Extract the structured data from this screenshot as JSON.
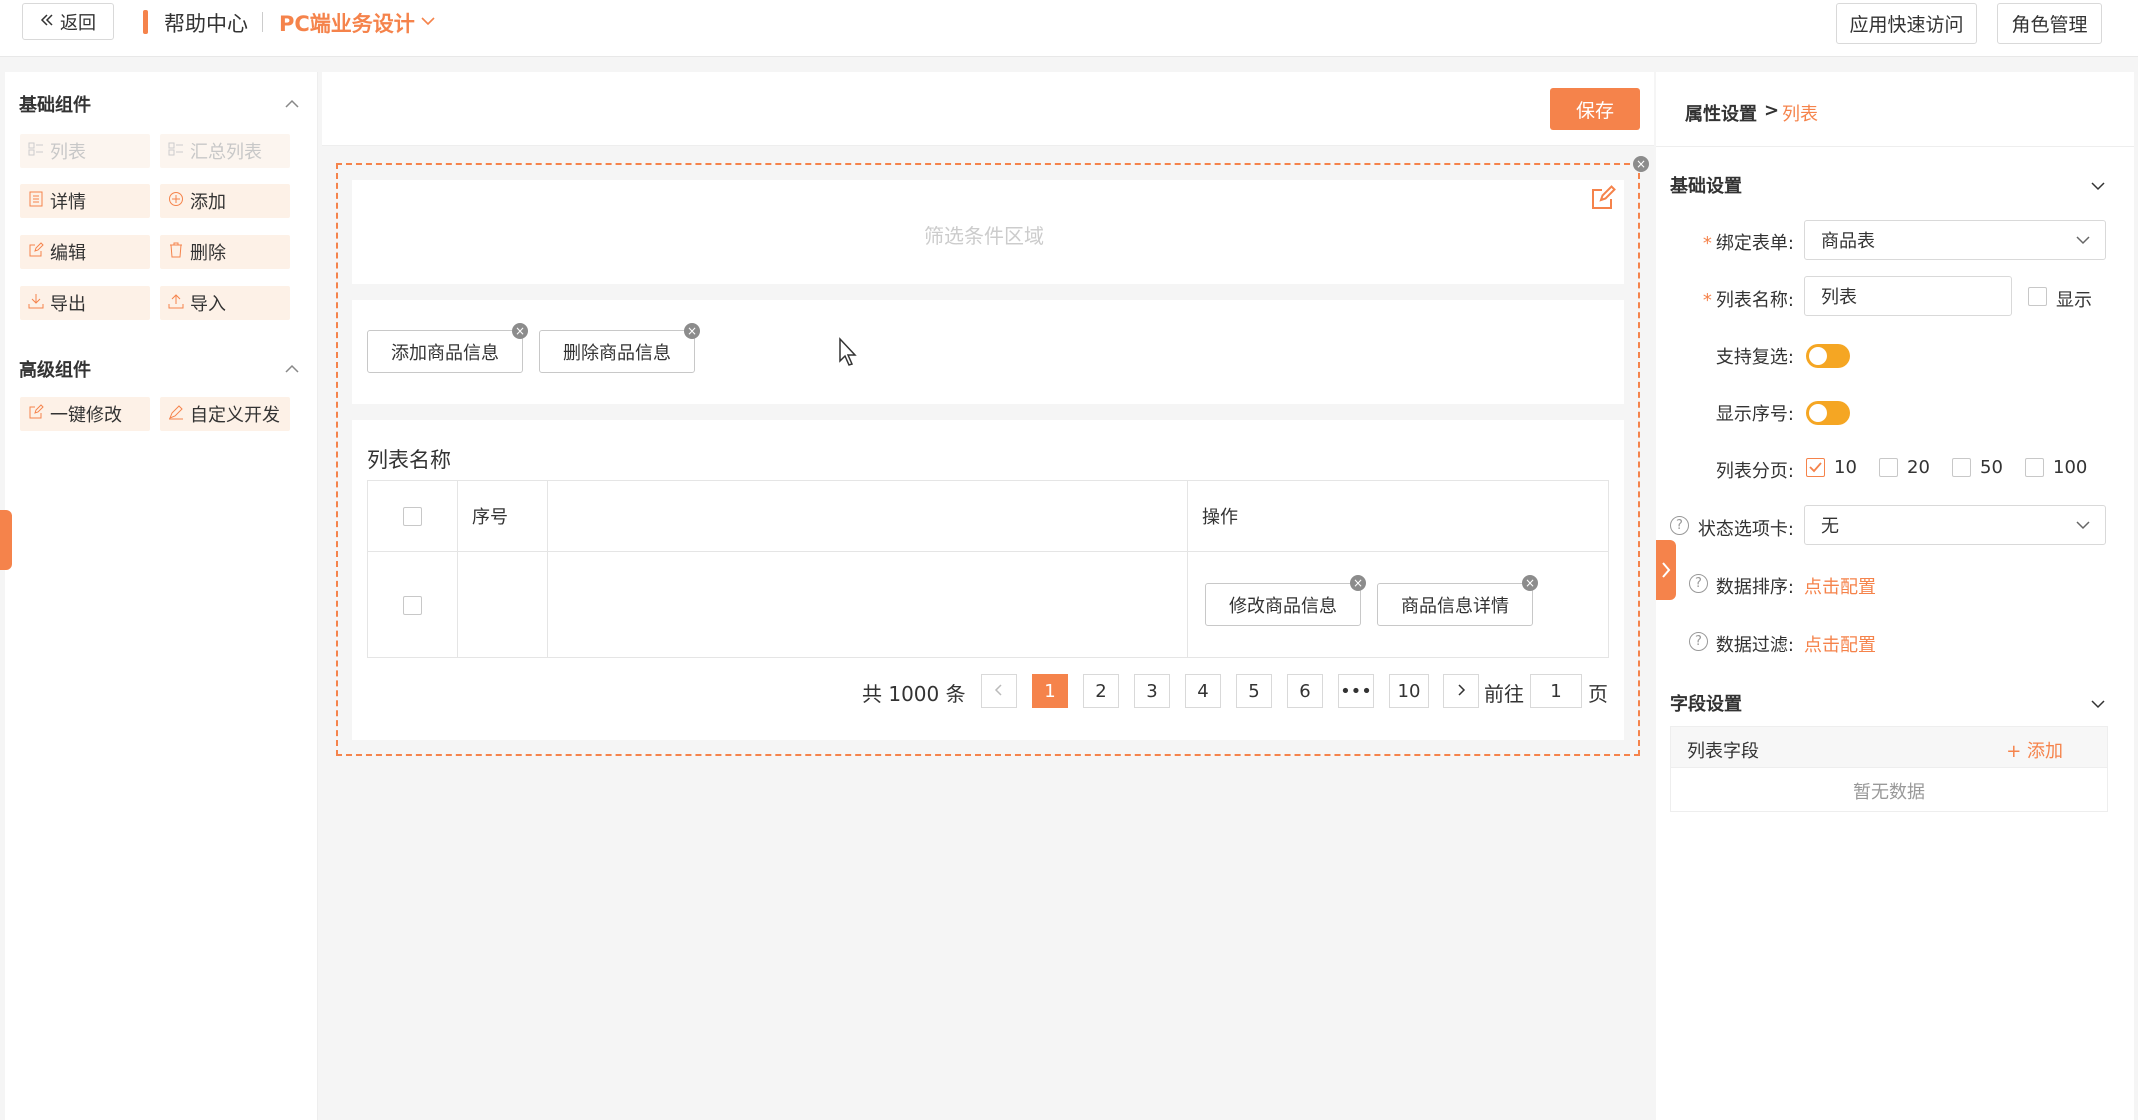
{
  "topbar": {
    "back_label": "返回",
    "help_center": "帮助中心",
    "project_title": "PC端业务设计",
    "quick_access": "应用快速访问",
    "role_manage": "角色管理"
  },
  "left": {
    "basic_title": "基础组件",
    "advanced_title": "高级组件",
    "basic_items": [
      {
        "label": "列表",
        "icon": "grid-list-icon"
      },
      {
        "label": "汇总列表",
        "icon": "summary-list-icon"
      },
      {
        "label": "详情",
        "icon": "document-icon"
      },
      {
        "label": "添加",
        "icon": "plus-circle-icon"
      },
      {
        "label": "编辑",
        "icon": "edit-icon"
      },
      {
        "label": "删除",
        "icon": "trash-icon"
      },
      {
        "label": "导出",
        "icon": "download-icon"
      },
      {
        "label": "导入",
        "icon": "upload-icon"
      }
    ],
    "advanced_items": [
      {
        "label": "一键修改",
        "icon": "edit-icon"
      },
      {
        "label": "自定义开发",
        "icon": "pen-icon"
      }
    ]
  },
  "center": {
    "save_label": "保存",
    "filter_placeholder": "筛选条件区域",
    "buttons": [
      "添加商品信息",
      "删除商品信息"
    ],
    "list_title": "列表名称",
    "table": {
      "col_index": "序号",
      "col_action": "操作",
      "row_actions": [
        "修改商品信息",
        "商品信息详情"
      ]
    },
    "pagination": {
      "total": "共 1000 条",
      "pages": [
        "1",
        "2",
        "3",
        "4",
        "5",
        "6",
        "•••",
        "10"
      ],
      "current": "1",
      "goto_label": "前往",
      "goto_value": "1",
      "page_unit": "页"
    }
  },
  "right": {
    "crumb_root": "属性设置",
    "crumb_sep": ">",
    "crumb_current": "列表",
    "basic_settings": "基础设置",
    "bind_form_label": "绑定表单:",
    "bind_form_value": "商品表",
    "list_name_label": "列表名称:",
    "list_name_value": "列表",
    "show_label": "显示",
    "multi_select_label": "支持复选:",
    "show_index_label": "显示序号:",
    "paging_label": "列表分页:",
    "paging_options": [
      "10",
      "20",
      "50",
      "100"
    ],
    "paging_checked": "10",
    "status_tab_label": "状态选项卡:",
    "status_tab_value": "无",
    "sort_label": "数据排序:",
    "sort_link": "点击配置",
    "filter_label": "数据过滤:",
    "filter_link": "点击配置",
    "field_settings": "字段设置",
    "list_fields": "列表字段",
    "add_label": "+ 添加",
    "empty": "暂无数据"
  },
  "colors": {
    "accent": "#f5834b",
    "toggle": "#f5a623"
  }
}
